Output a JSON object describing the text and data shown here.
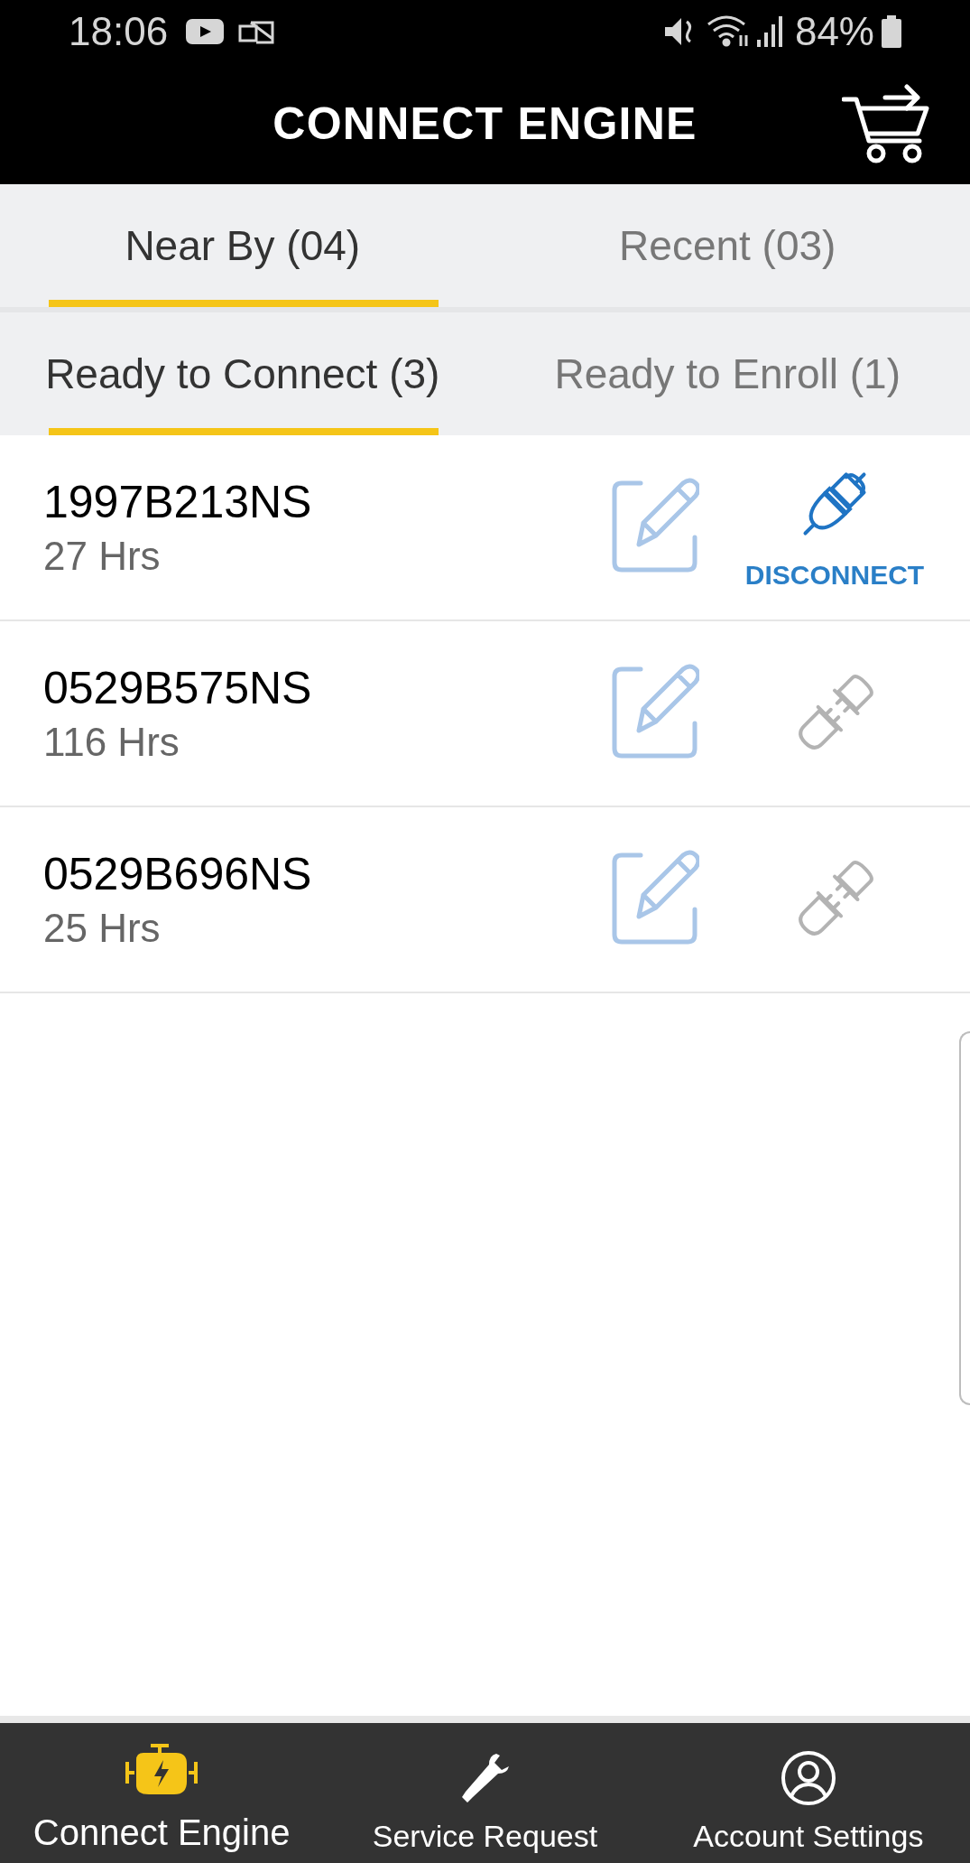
{
  "status_bar": {
    "time": "18:06",
    "battery": "84%"
  },
  "header": {
    "title": "CONNECT ENGINE"
  },
  "tabs": [
    {
      "label": "Near By (04)",
      "selected": true
    },
    {
      "label": "Recent (03)",
      "selected": false
    }
  ],
  "subtabs": [
    {
      "label": "Ready to Connect (3)",
      "selected": true
    },
    {
      "label": "Ready to Enroll (1)",
      "selected": false
    }
  ],
  "engines": [
    {
      "serial": "1997B213NS",
      "hours": "27 Hrs",
      "connected": true,
      "action": "DISCONNECT"
    },
    {
      "serial": "0529B575NS",
      "hours": "116 Hrs",
      "connected": false
    },
    {
      "serial": "0529B696NS",
      "hours": "25 Hrs",
      "connected": false
    }
  ],
  "bottom_nav": [
    {
      "label": "Connect Engine",
      "kind": "engine",
      "selected": true
    },
    {
      "label": "Service Request",
      "kind": "wrench",
      "selected": false
    },
    {
      "label": "Account Settings",
      "kind": "account",
      "selected": false
    }
  ]
}
